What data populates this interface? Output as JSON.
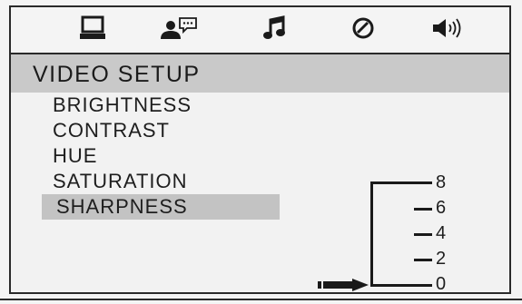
{
  "icons": [
    "monitor-icon",
    "speaker-person-icon",
    "music-note-icon",
    "disc-icon",
    "speaker-volume-icon"
  ],
  "title": "VIDEO SETUP",
  "menu_items": [
    {
      "label": "BRIGHTNESS",
      "selected": false
    },
    {
      "label": "CONTRAST",
      "selected": false
    },
    {
      "label": "HUE",
      "selected": false
    },
    {
      "label": "SATURATION",
      "selected": false
    },
    {
      "label": "SHARPNESS",
      "selected": true
    }
  ],
  "sharpness_scale": {
    "ticks": [
      "8",
      "6",
      "4",
      "2",
      "0"
    ],
    "current_value": "0"
  },
  "colors": {
    "background": "#f4f4f4",
    "title_bar": "#c9c9c9",
    "selection": "#c3c3c3",
    "ink": "#1c1c1c"
  }
}
